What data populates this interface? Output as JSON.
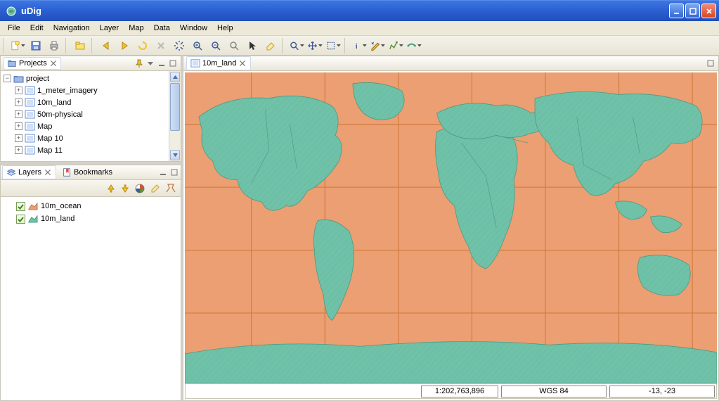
{
  "app": {
    "title": "uDig"
  },
  "menu": [
    "File",
    "Edit",
    "Navigation",
    "Layer",
    "Map",
    "Data",
    "Window",
    "Help"
  ],
  "views": {
    "projects": {
      "title": "Projects"
    },
    "layers": {
      "title": "Layers"
    },
    "bookmarks": {
      "title": "Bookmarks"
    }
  },
  "projects_tree": {
    "root": "project",
    "children": [
      "1_meter_imagery",
      "10m_land",
      "50m-physical",
      "Map",
      "Map 10",
      "Map 11"
    ]
  },
  "layers_list": [
    {
      "name": "10m_ocean",
      "color": "#eb9f72"
    },
    {
      "name": "10m_land",
      "color": "#6fc1a8"
    }
  ],
  "editor": {
    "tab": "10m_land"
  },
  "status": {
    "scale": "1:202,763,896",
    "crs": "WGS 84",
    "coords": "-13, -23"
  },
  "colors": {
    "ocean": "#eb9f72",
    "land": "#6fc1a8",
    "land_stroke": "#4d9a82",
    "grid": "#d2763a"
  }
}
